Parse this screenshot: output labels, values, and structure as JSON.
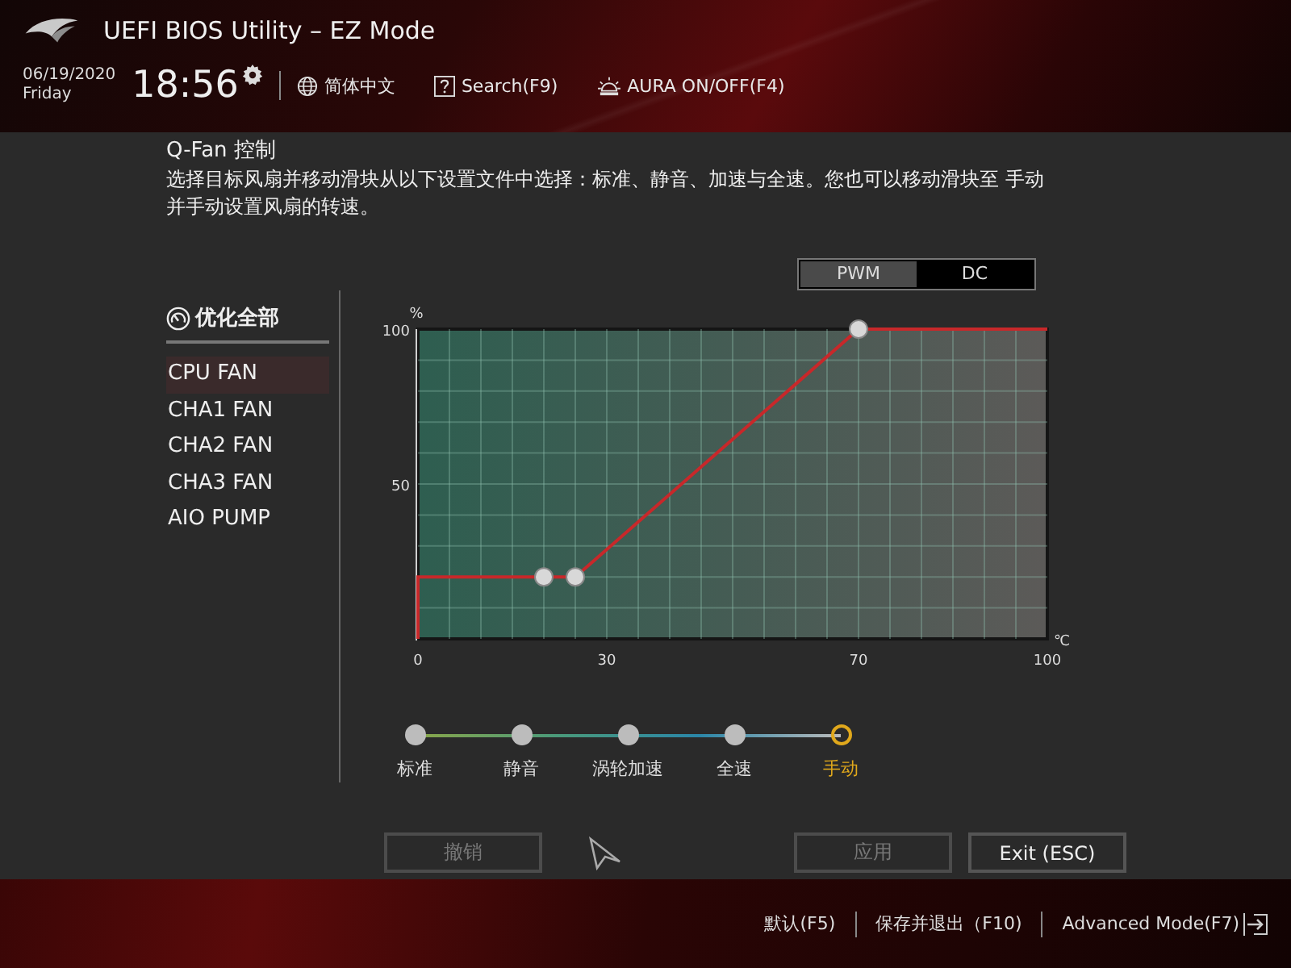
{
  "header": {
    "title": "UEFI BIOS Utility – EZ Mode",
    "date": "06/19/2020",
    "weekday": "Friday",
    "time": "18:56",
    "tools": [
      {
        "kind": "language",
        "label": "简体中文"
      },
      {
        "kind": "search",
        "label": "Search(F9)"
      },
      {
        "kind": "aura",
        "label": "AURA ON/OFF(F4)"
      }
    ]
  },
  "dialog": {
    "title": "Q-Fan 控制",
    "description": "选择目标风扇并移动滑块从以下设置文件中选择：标准、静音、加速与全速。您也可以移动滑块至 手动并手动设置风扇的转速。",
    "modes": [
      {
        "label": "PWM",
        "selected": true
      },
      {
        "label": "DC",
        "selected": false
      }
    ],
    "optimize_label": "优化全部",
    "fans": [
      {
        "label": "CPU FAN",
        "selected": true
      },
      {
        "label": "CHA1 FAN",
        "selected": false
      },
      {
        "label": "CHA2 FAN",
        "selected": false
      },
      {
        "label": "CHA3 FAN",
        "selected": false
      },
      {
        "label": "AIO PUMP",
        "selected": false
      }
    ],
    "chart_data": {
      "type": "line",
      "xlabel": "℃",
      "ylabel": "%",
      "x": [
        0,
        0,
        20,
        25,
        70,
        100
      ],
      "series": [
        {
          "color": "#c8282a",
          "values": [
            0,
            20,
            20,
            20,
            100,
            100
          ]
        }
      ],
      "xlim": [
        0,
        100
      ],
      "ylim": [
        0,
        100
      ],
      "xticks": [
        0,
        30,
        70,
        100
      ],
      "yticks": [
        50,
        100
      ],
      "grid": true
    },
    "profiles": [
      {
        "label": "标准",
        "selected": false
      },
      {
        "label": "静音",
        "selected": false
      },
      {
        "label": "涡轮加速",
        "selected": false
      },
      {
        "label": "全速",
        "selected": false
      },
      {
        "label": "手动",
        "selected": true
      }
    ],
    "buttons": [
      {
        "kind": "undo",
        "label": "撤销",
        "disabled": true
      },
      {
        "kind": "apply",
        "label": "应用",
        "disabled": true
      },
      {
        "kind": "exit",
        "label": "Exit (ESC)",
        "disabled": false
      }
    ]
  },
  "footer": [
    {
      "kind": "default",
      "label": "默认(F5)"
    },
    {
      "kind": "save",
      "label": "保存并退出（F10)"
    },
    {
      "kind": "advanced",
      "label": "Advanced Mode(F7)"
    }
  ]
}
